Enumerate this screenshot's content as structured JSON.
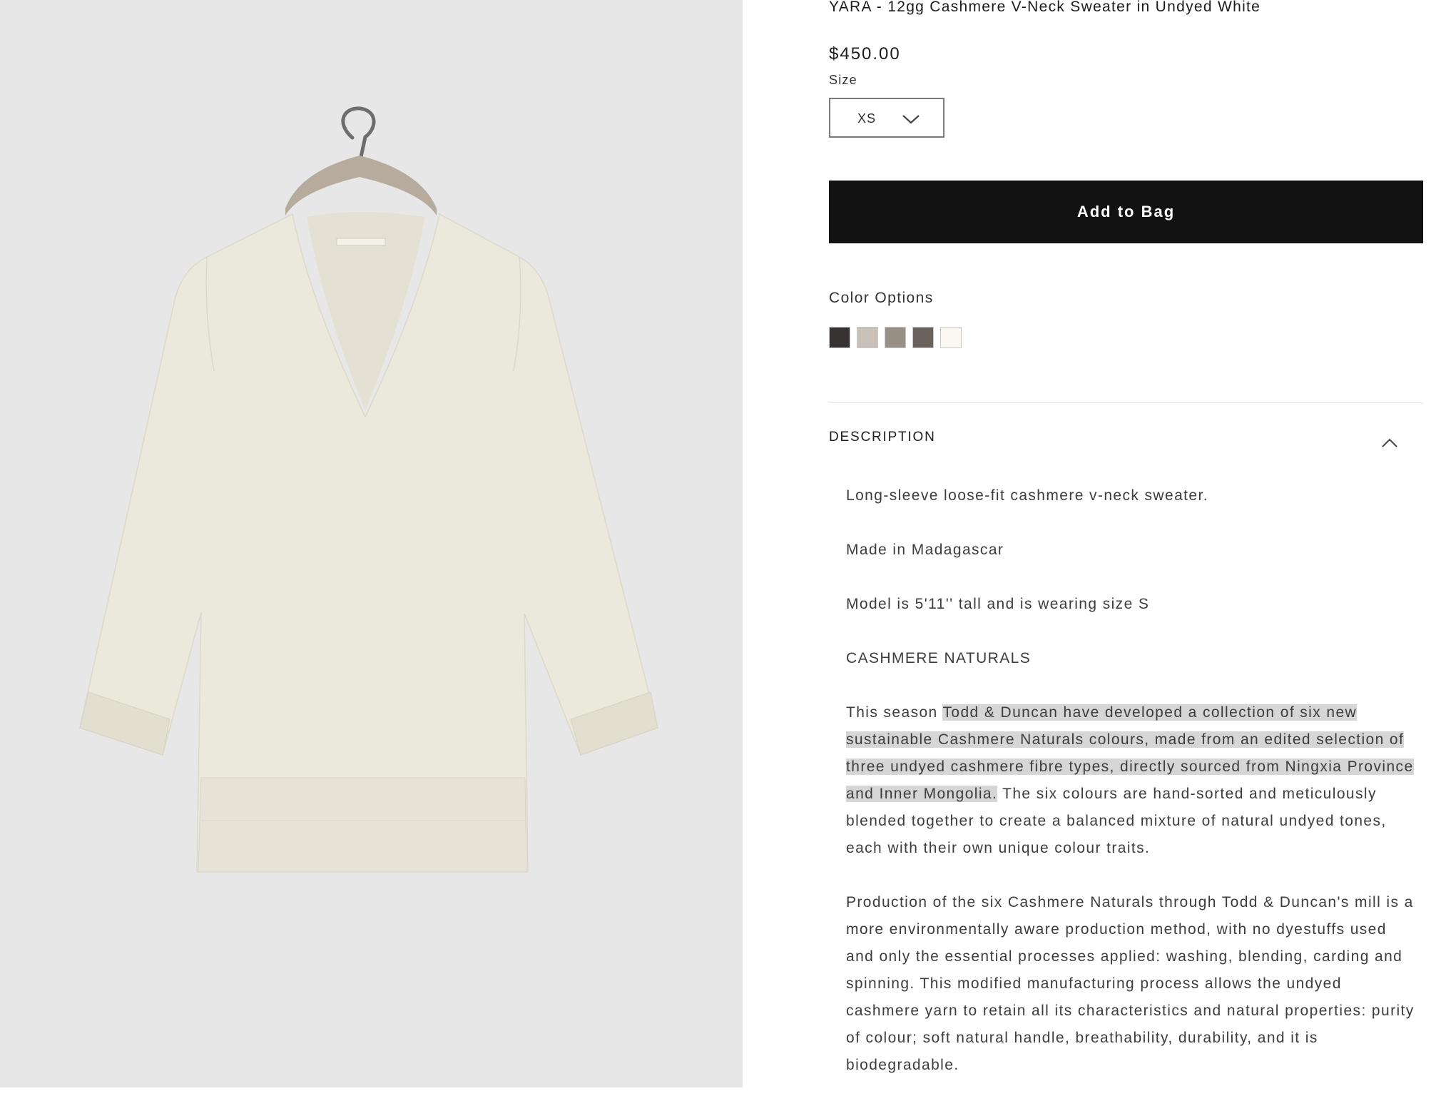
{
  "product": {
    "title": "YARA - 12gg Cashmere V-Neck Sweater in Undyed White",
    "price": "$450.00"
  },
  "size": {
    "label": "Size",
    "selected": "XS"
  },
  "actions": {
    "add_to_bag": "Add to Bag"
  },
  "colors": {
    "title": "Color Options",
    "swatches": [
      "#363231",
      "#c9c0b8",
      "#9a8f85",
      "#6c625c",
      "#fbf8ef"
    ]
  },
  "description": {
    "heading": "DESCRIPTION",
    "line1": "Long-sleeve loose-fit cashmere v-neck sweater.",
    "line2": "Made in Madagascar",
    "line3": "Model is 5'11'' tall and is wearing size S",
    "line4": "CASHMERE NATURALS",
    "para1_start": "This season ",
    "para1_highlight": "Todd & Duncan have developed a collection of six new sustainable Cashmere Naturals colours, made from an edited selection of three undyed cashmere fibre types, directly sourced from Ningxia Province and Inner Mongolia.",
    "para1_end": " The six colours are hand-sorted and meticulously blended together to create a balanced mixture of natural undyed tones, each with their own unique colour traits.",
    "para2": "Production of the six Cashmere Naturals through Todd & Duncan's mill is a more environmentally aware production method, with no dyestuffs used and only the essential processes applied: washing, blending, carding and spinning. This modified manufacturing process allows the undyed cashmere yarn to retain all its characteristics and natural properties: purity of colour; soft natural handle, breathability, durability, and it is biodegradable."
  },
  "colors_theme": {
    "button_bg": "#121212",
    "image_bg": "#e7e7e7",
    "highlight": "#d6d6d6",
    "garment": "#ebe8dc"
  }
}
